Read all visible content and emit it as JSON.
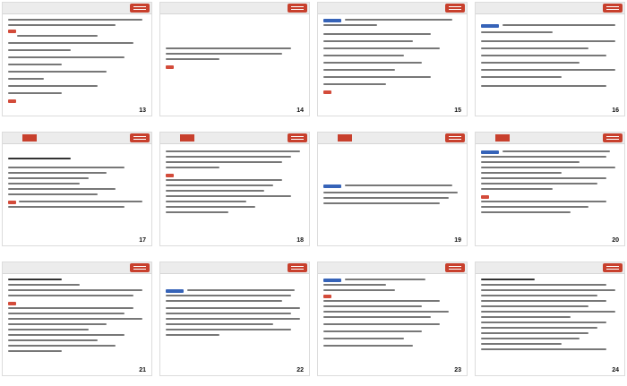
{
  "slides": [
    {
      "number": "13",
      "tabs": [
        "",
        "",
        "",
        "",
        ""
      ],
      "active_tab": -1
    },
    {
      "number": "14",
      "tabs": [
        "",
        "",
        "",
        "",
        ""
      ],
      "active_tab": -1
    },
    {
      "number": "15",
      "tabs": [
        "",
        "",
        "",
        "",
        ""
      ],
      "active_tab": -1
    },
    {
      "number": "16",
      "tabs": [
        "",
        "",
        "",
        "",
        ""
      ],
      "active_tab": -1
    },
    {
      "number": "17",
      "tabs": [
        "",
        "",
        "",
        "",
        ""
      ],
      "active_tab": 1
    },
    {
      "number": "18",
      "tabs": [
        "",
        "",
        "",
        "",
        ""
      ],
      "active_tab": 1
    },
    {
      "number": "19",
      "tabs": [
        "",
        "",
        "",
        "",
        ""
      ],
      "active_tab": 1
    },
    {
      "number": "20",
      "tabs": [
        "",
        "",
        "",
        "",
        ""
      ],
      "active_tab": 1
    },
    {
      "number": "21",
      "tabs": [
        "",
        "",
        "",
        "",
        ""
      ],
      "active_tab": -1
    },
    {
      "number": "22",
      "tabs": [
        "",
        "",
        "",
        "",
        ""
      ],
      "active_tab": -1
    },
    {
      "number": "23",
      "tabs": [
        "",
        "",
        "",
        "",
        ""
      ],
      "active_tab": -1
    },
    {
      "number": "24",
      "tabs": [
        "",
        "",
        "",
        "",
        ""
      ],
      "active_tab": -1
    }
  ]
}
